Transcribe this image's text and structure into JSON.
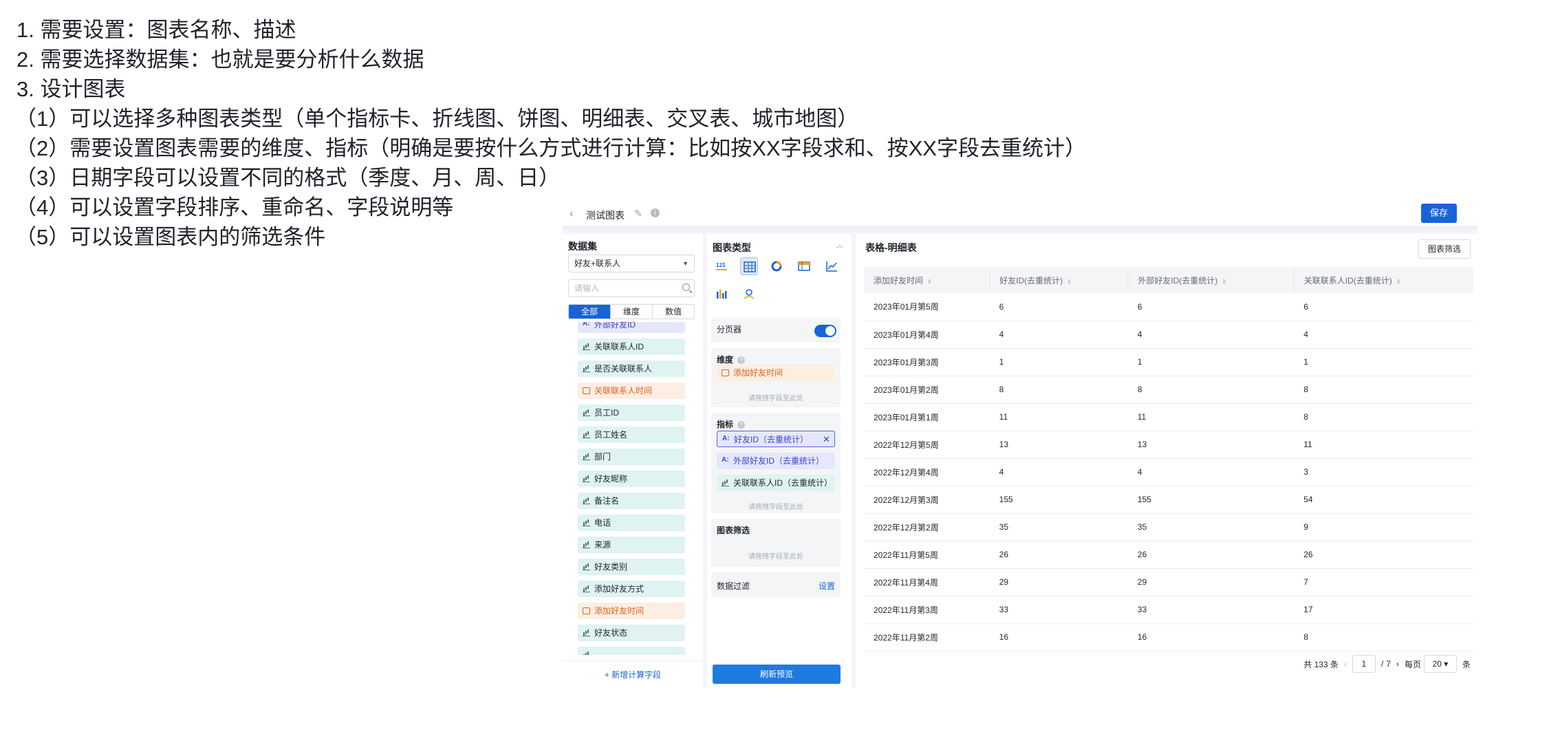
{
  "notes": [
    "1.   需要设置：图表名称、描述",
    "2.   需要选择数据集：也就是要分析什么数据",
    "3.   设计图表",
    "（1）可以选择多种图表类型（单个指标卡、折线图、饼图、明细表、交叉表、城市地图）",
    "（2）需要设置图表需要的维度、指标（明确是要按什么方式进行计算：比如按XX字段求和、按XX字段去重统计）",
    "（3）日期字段可以设置不同的格式（季度、月、周、日）",
    "（4）可以设置字段排序、重命名、字段说明等",
    "（5）可以设置图表内的筛选条件"
  ],
  "topbar": {
    "back": "‹",
    "title": "测试图表",
    "save": "保存"
  },
  "dataset": {
    "heading": "数据集",
    "selected": "好友+联系人",
    "search_placeholder": "请输入",
    "tabs": [
      "全部",
      "维度",
      "数值"
    ],
    "fields": [
      {
        "label": "外部好友ID",
        "type": "text"
      },
      {
        "label": "关联联系人ID",
        "type": "metric"
      },
      {
        "label": "是否关联联系人",
        "type": "metric"
      },
      {
        "label": "关联联系人时间",
        "type": "date"
      },
      {
        "label": "员工ID",
        "type": "metric"
      },
      {
        "label": "员工姓名",
        "type": "metric"
      },
      {
        "label": "部门",
        "type": "metric"
      },
      {
        "label": "好友昵称",
        "type": "metric"
      },
      {
        "label": "备注名",
        "type": "metric"
      },
      {
        "label": "电话",
        "type": "metric"
      },
      {
        "label": "来源",
        "type": "metric"
      },
      {
        "label": "好友类别",
        "type": "metric"
      },
      {
        "label": "添加好友方式",
        "type": "metric"
      },
      {
        "label": "添加好友时间",
        "type": "date"
      },
      {
        "label": "好友状态",
        "type": "metric"
      },
      {
        "label": "",
        "type": "metric"
      }
    ],
    "add_field": "+ 新增计算字段"
  },
  "chart_type": {
    "heading": "图表类型",
    "pager_label": "分页器",
    "dimension_label": "维度",
    "dimension_chip": "添加好友时间",
    "drop_hint": "请拖拽字段至此处",
    "metric_label": "指标",
    "metric_chips": [
      {
        "label": "好友ID（去重统计）",
        "type": "text"
      },
      {
        "label": "外部好友ID（去重统计）",
        "type": "text"
      },
      {
        "label": "关联联系人ID（去重统计）",
        "type": "metric"
      }
    ],
    "filter_label": "图表筛选",
    "datafilter_label": "数据过滤",
    "datafilter_set": "设置",
    "refresh": "刷新预览"
  },
  "table": {
    "heading": "表格-明细表",
    "filter_btn": "图表筛选",
    "columns": [
      "添加好友时间",
      "好友ID(去重统计)",
      "外部好友ID(去重统计)",
      "关联联系人ID(去重统计)"
    ],
    "rows": [
      [
        "2023年01月第5周",
        "6",
        "6",
        "6"
      ],
      [
        "2023年01月第4周",
        "4",
        "4",
        "4"
      ],
      [
        "2023年01月第3周",
        "1",
        "1",
        "1"
      ],
      [
        "2023年01月第2周",
        "8",
        "8",
        "8"
      ],
      [
        "2023年01月第1周",
        "11",
        "11",
        "8"
      ],
      [
        "2022年12月第5周",
        "13",
        "13",
        "11"
      ],
      [
        "2022年12月第4周",
        "4",
        "4",
        "3"
      ],
      [
        "2022年12月第3周",
        "155",
        "155",
        "54"
      ],
      [
        "2022年12月第2周",
        "35",
        "35",
        "9"
      ],
      [
        "2022年11月第5周",
        "26",
        "26",
        "26"
      ],
      [
        "2022年11月第4周",
        "29",
        "29",
        "7"
      ],
      [
        "2022年11月第3周",
        "33",
        "33",
        "17"
      ],
      [
        "2022年11月第2周",
        "16",
        "16",
        "8"
      ]
    ],
    "pager": {
      "total": "共 133 条",
      "page": "1",
      "sep": "/",
      "pages": "7",
      "per_label": "每页",
      "per_value": "20 ▾",
      "unit": "条"
    }
  }
}
